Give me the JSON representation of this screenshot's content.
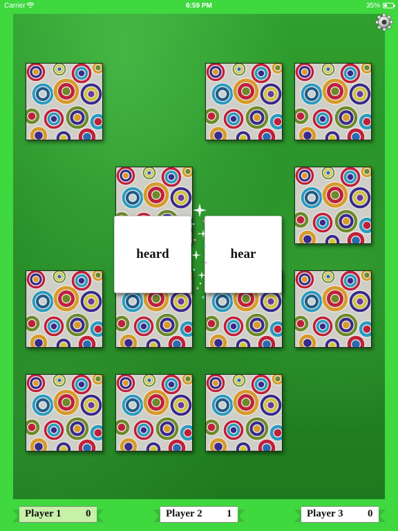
{
  "status_bar": {
    "carrier": "Carrier",
    "time": "6:59 PM",
    "battery_pct": "35%",
    "battery_fraction": 0.35
  },
  "icons": {
    "settings": "gear-icon",
    "wifi": "wifi-icon",
    "battery": "battery-icon"
  },
  "colors": {
    "page_background": "#3fd83f",
    "board_green": "#258a25",
    "active_player_ribbon": "#c7f0a8",
    "ribbon_tail_green": "#3cb83c"
  },
  "board": {
    "grid_columns": 4,
    "grid_rows": 4,
    "face_down_cards": [
      {
        "row": 0,
        "col": 0
      },
      {
        "row": 0,
        "col": 2
      },
      {
        "row": 0,
        "col": 3
      },
      {
        "row": 1,
        "col": 1
      },
      {
        "row": 1,
        "col": 3
      },
      {
        "row": 2,
        "col": 0
      },
      {
        "row": 2,
        "col": 1
      },
      {
        "row": 2,
        "col": 2
      },
      {
        "row": 2,
        "col": 3
      },
      {
        "row": 3,
        "col": 0
      },
      {
        "row": 3,
        "col": 1
      },
      {
        "row": 3,
        "col": 2
      }
    ],
    "revealed_cards": [
      {
        "word": "heard"
      },
      {
        "word": "hear"
      }
    ]
  },
  "players": [
    {
      "name": "Player 1",
      "score": "0",
      "active": true
    },
    {
      "name": "Player 2",
      "score": "1",
      "active": false
    },
    {
      "name": "Player 3",
      "score": "0",
      "active": false
    }
  ]
}
